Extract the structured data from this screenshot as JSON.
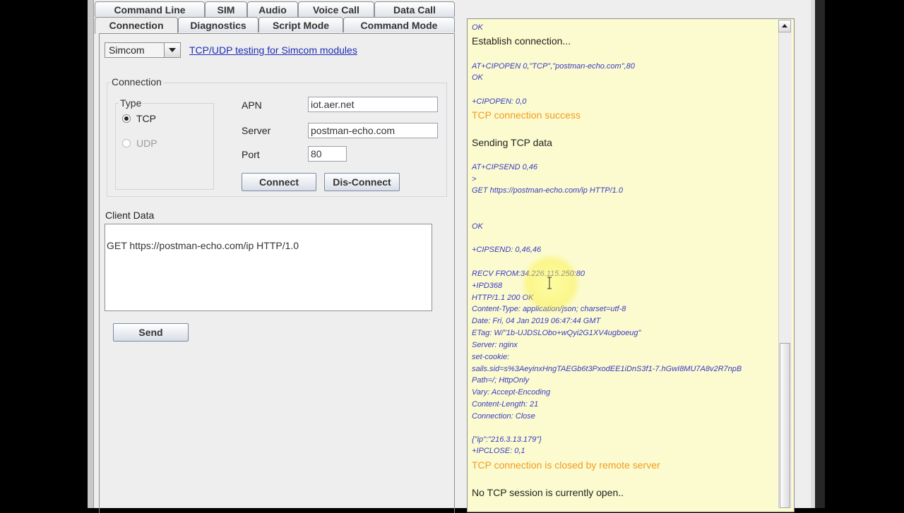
{
  "tabs_row1": [
    "Command Line",
    "SIM",
    "Audio",
    "Voice Call",
    "Data Call"
  ],
  "tabs_row2": [
    "Connection",
    "Diagnostics",
    "Script Mode",
    "Command Mode"
  ],
  "module_select": "Simcom",
  "header_link": "TCP/UDP testing for Simcom modules",
  "connection": {
    "group_title": "Connection",
    "type_title": "Type",
    "radio_tcp": "TCP",
    "radio_udp": "UDP",
    "apn_label": "APN",
    "apn_value": "iot.aer.net",
    "server_label": "Server",
    "server_value": "postman-echo.com",
    "port_label": "Port",
    "port_value": "80",
    "connect_button": "Connect",
    "disconnect_button": "Dis-Connect"
  },
  "client_data": {
    "label": "Client Data",
    "value": "GET https://postman-echo.com/ip HTTP/1.0",
    "send_button": "Send"
  },
  "console_lines": [
    {
      "text": "OK",
      "style": "cmd"
    },
    {
      "text": "Establish connection...",
      "style": "plain"
    },
    {
      "text": "AT+CIPOPEN 0,\"TCP\",\"postman-echo.com\",80",
      "style": "cmd"
    },
    {
      "text": "OK",
      "style": "cmd"
    },
    {
      "text": "+CIPOPEN: 0,0",
      "style": "cmd"
    },
    {
      "text": "TCP connection success",
      "style": "orange"
    },
    {
      "text": "Sending TCP data",
      "style": "plain"
    },
    {
      "text": "AT+CIPSEND 0,46",
      "style": "cmd"
    },
    {
      "text": ">",
      "style": "cmd"
    },
    {
      "text": "GET https://postman-echo.com/ip HTTP/1.0",
      "style": "cmd"
    },
    {
      "text": "OK",
      "style": "cmd"
    },
    {
      "text": "+CIPSEND: 0,46,46",
      "style": "cmd"
    },
    {
      "text": "RECV FROM:34.226.115.250:80",
      "style": "cmd"
    },
    {
      "text": "+IPD368",
      "style": "cmd"
    },
    {
      "text": "HTTP/1.1 200 OK",
      "style": "cmd"
    },
    {
      "text": "Content-Type: application/json; charset=utf-8",
      "style": "cmd"
    },
    {
      "text": "Date: Fri, 04 Jan 2019 06:47:44 GMT",
      "style": "cmd"
    },
    {
      "text": "ETag: W/\"1b-UJDSLObo+wQyi2G1XV4ugboeug\"",
      "style": "cmd"
    },
    {
      "text": "Server: nginx",
      "style": "cmd"
    },
    {
      "text": "set-cookie:",
      "style": "cmd"
    },
    {
      "text": "sails.sid=s%3AeyinxHngTAEGb6t3PxodEE1iDnS3f1-7.hGwI8MU7A8v2R7npB",
      "style": "cmd"
    },
    {
      "text": " Path=/; HttpOnly",
      "style": "cmd"
    },
    {
      "text": "Vary: Accept-Encoding",
      "style": "cmd"
    },
    {
      "text": "Content-Length: 21",
      "style": "cmd"
    },
    {
      "text": "Connection: Close",
      "style": "cmd"
    },
    {
      "text": "{\"ip\":\"216.3.13.179\"}",
      "style": "cmd"
    },
    {
      "text": "+IPCLOSE: 0,1",
      "style": "cmd"
    },
    {
      "text": "TCP connection is closed by remote server",
      "style": "orange"
    },
    {
      "text": "No TCP session is currently open..",
      "style": "plain"
    }
  ]
}
